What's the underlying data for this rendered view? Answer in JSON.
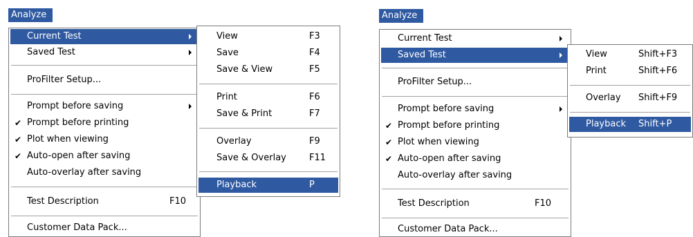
{
  "left": {
    "menubar_label": "Analyze",
    "main_menu": {
      "current_test": "Current Test",
      "saved_test": "Saved Test",
      "profilter_setup": "ProFilter Setup...",
      "prompt_before_saving": "Prompt before saving",
      "prompt_before_printing": "Prompt before printing",
      "plot_when_viewing": "Plot when viewing",
      "auto_open_after_saving": "Auto-open after saving",
      "auto_overlay_after_saving": "Auto-overlay after saving",
      "test_description": "Test Description",
      "test_description_shortcut": "F10",
      "customer_data_pack": "Customer Data Pack..."
    },
    "submenu": {
      "view": "View",
      "view_sc": "F3",
      "save": "Save",
      "save_sc": "F4",
      "save_view": "Save & View",
      "save_view_sc": "F5",
      "print": "Print",
      "print_sc": "F6",
      "save_print": "Save & Print",
      "save_print_sc": "F7",
      "overlay": "Overlay",
      "overlay_sc": "F9",
      "save_overlay": "Save & Overlay",
      "save_overlay_sc": "F11",
      "playback": "Playback",
      "playback_sc": "P"
    }
  },
  "right": {
    "menubar_label": "Analyze",
    "main_menu": {
      "current_test": "Current Test",
      "saved_test": "Saved Test",
      "profilter_setup": "ProFilter Setup...",
      "prompt_before_saving": "Prompt before saving",
      "prompt_before_printing": "Prompt before printing",
      "plot_when_viewing": "Plot when viewing",
      "auto_open_after_saving": "Auto-open after saving",
      "auto_overlay_after_saving": "Auto-overlay after saving",
      "test_description": "Test Description",
      "test_description_shortcut": "F10",
      "customer_data_pack": "Customer Data Pack..."
    },
    "submenu": {
      "view": "View",
      "view_sc": "Shift+F3",
      "print": "Print",
      "print_sc": "Shift+F6",
      "overlay": "Overlay",
      "overlay_sc": "Shift+F9",
      "playback": "Playback",
      "playback_sc": "Shift+P"
    }
  },
  "icons": {
    "checkmark": "✔",
    "submenu_arrow": "triangle-right"
  },
  "colors": {
    "highlight": "#2f5aa2",
    "border": "#7a7a7a"
  }
}
